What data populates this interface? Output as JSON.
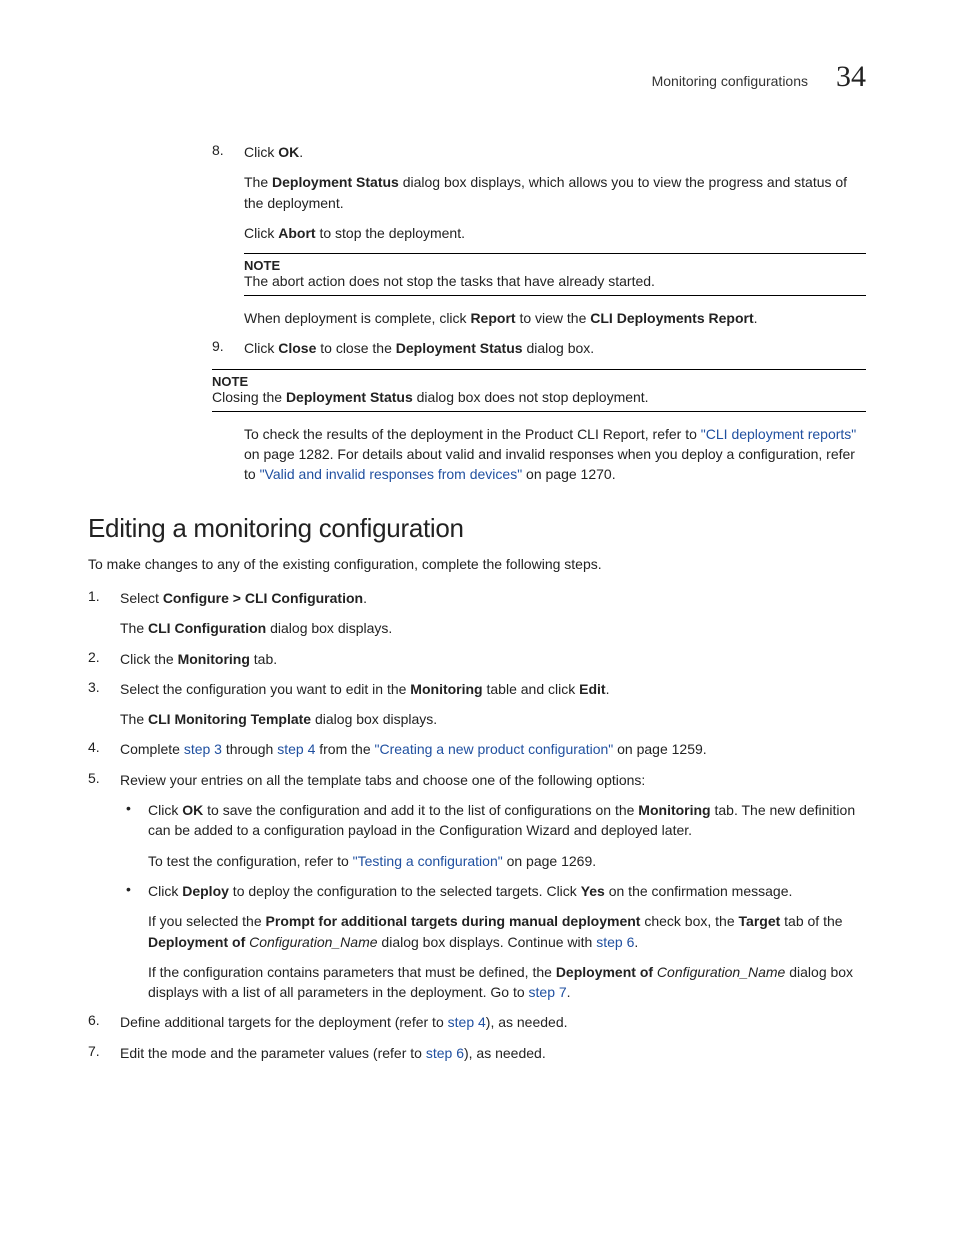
{
  "header": {
    "running_title": "Monitoring configurations",
    "chapter_number": "34"
  },
  "steps_a": [
    {
      "num": "8.",
      "line1_pre": "Click ",
      "line1_b": "OK",
      "line1_post": ".",
      "p2_pre": "The ",
      "p2_b": "Deployment Status",
      "p2_post": " dialog box displays, which allows you to view the progress and status of the deployment.",
      "p3_pre": "Click ",
      "p3_b": "Abort",
      "p3_post": " to stop the deployment.",
      "note_label": "NOTE",
      "note_text": "The abort action does not stop the tasks that have already started.",
      "p4_pre": "When deployment is complete, click ",
      "p4_b1": "Report",
      "p4_mid": " to view the ",
      "p4_b2": "CLI Deployments Report",
      "p4_post": "."
    },
    {
      "num": "9.",
      "line1_pre": "Click ",
      "line1_b1": "Close",
      "line1_mid": " to close the ",
      "line1_b2": "Deployment Status",
      "line1_post": " dialog box.",
      "note_label": "NOTE",
      "note_pre": "Closing the ",
      "note_b": "Deployment Status",
      "note_post": " dialog box does not stop deployment.",
      "p3_pre": "To check the results of the deployment in the Product CLI Report, refer to ",
      "p3_link1": "\"CLI deployment reports\"",
      "p3_mid": " on page 1282. For details about valid and invalid responses when you deploy a configuration, refer to ",
      "p3_link2": "\"Valid and invalid responses from devices\"",
      "p3_post": " on page 1270."
    }
  ],
  "section_heading": "Editing a monitoring configuration",
  "section_intro": "To make changes to any of the existing configuration, complete the following steps.",
  "steps_b": [
    {
      "num": "1.",
      "l1_pre": "Select ",
      "l1_b": "Configure > CLI Configuration",
      "l1_post": ".",
      "p2_pre": "The ",
      "p2_b": "CLI Configuration",
      "p2_post": " dialog box displays."
    },
    {
      "num": "2.",
      "l1_pre": "Click the ",
      "l1_b": "Monitoring",
      "l1_post": " tab."
    },
    {
      "num": "3.",
      "l1_pre": "Select the configuration you want to edit in the ",
      "l1_b1": "Monitoring",
      "l1_mid": " table and click ",
      "l1_b2": "Edit",
      "l1_post": ".",
      "p2_pre": "The ",
      "p2_b": "CLI Monitoring Template",
      "p2_post": " dialog box displays."
    },
    {
      "num": "4.",
      "l1_pre": "Complete ",
      "l1_link1": "step 3",
      "l1_mid1": " through ",
      "l1_link2": "step 4",
      "l1_mid2": " from the ",
      "l1_link3": "\"Creating a new product configuration\"",
      "l1_post": " on page 1259."
    },
    {
      "num": "5.",
      "l1": "Review your entries on all the template tabs and choose one of the following options:",
      "bullets": [
        {
          "p1_pre": "Click ",
          "p1_b1": "OK",
          "p1_mid": " to save the configuration and add it to the list of configurations on the ",
          "p1_b2": "Monitoring",
          "p1_post": " tab. The new definition can be added to a configuration payload in the Configuration Wizard and deployed later.",
          "p2_pre": "To test the configuration, refer to ",
          "p2_link": "\"Testing a configuration\"",
          "p2_post": " on page 1269."
        },
        {
          "p1_pre": "Click ",
          "p1_b1": "Deploy",
          "p1_mid": " to deploy the configuration to the selected targets. Click ",
          "p1_b2": "Yes",
          "p1_post": " on the confirmation message.",
          "p2_pre": "If you selected the ",
          "p2_b1": "Prompt for additional targets during manual deployment",
          "p2_mid1": " check box, the ",
          "p2_b2": "Target",
          "p2_mid2": " tab of the ",
          "p2_b3": "Deployment of",
          "p2_i": " Configuration_Name",
          "p2_post1": " dialog box displays. Continue with ",
          "p2_link": "step 6",
          "p2_post2": ".",
          "p3_pre": "If the configuration contains parameters that must be defined, the ",
          "p3_b": "Deployment of",
          "p3_i": " Configuration_Name",
          "p3_mid": " dialog box displays with a list of all parameters in the deployment. Go to ",
          "p3_link": "step 7",
          "p3_post": "."
        }
      ]
    },
    {
      "num": "6.",
      "l1_pre": "Define additional targets for the deployment (refer to ",
      "l1_link": "step 4",
      "l1_post": "), as needed."
    },
    {
      "num": "7.",
      "l1_pre": "Edit the mode and the parameter values (refer to ",
      "l1_link": "step 6",
      "l1_post": "), as needed."
    }
  ]
}
